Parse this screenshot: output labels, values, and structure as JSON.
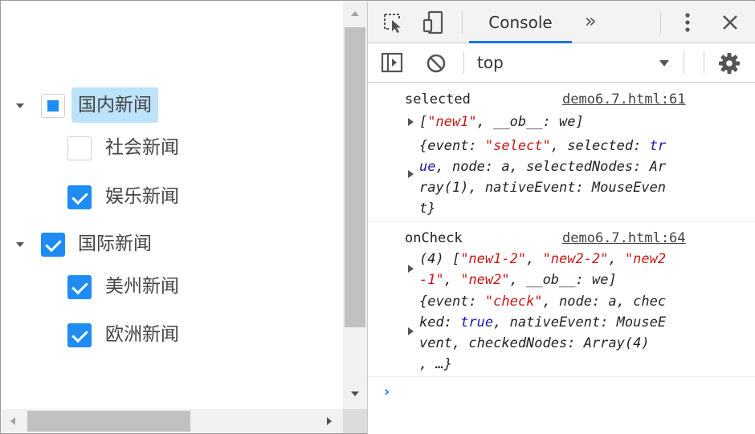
{
  "tree": {
    "nodes": [
      {
        "label": "国内新闻",
        "state": "indeterminate",
        "selected": true,
        "expanded": true,
        "level": 0
      },
      {
        "label": "社会新闻",
        "state": "unchecked",
        "selected": false,
        "level": 1
      },
      {
        "label": "娱乐新闻",
        "state": "checked",
        "selected": false,
        "level": 1
      },
      {
        "label": "国际新闻",
        "state": "checked",
        "selected": false,
        "expanded": true,
        "level": 0
      },
      {
        "label": "美州新闻",
        "state": "checked",
        "selected": false,
        "level": 1
      },
      {
        "label": "欧洲新闻",
        "state": "checked",
        "selected": false,
        "level": 1
      }
    ]
  },
  "devtools": {
    "tabs": {
      "active": "Console",
      "more": "»"
    },
    "context": "top",
    "icons": {
      "inspect": "inspect-element-icon",
      "device": "device-toolbar-icon",
      "menu": "more-options-icon",
      "close": "close-icon",
      "sidebar": "console-sidebar-icon",
      "clear": "clear-console-icon",
      "dropdown": "chevron-down-icon",
      "settings": "gear-icon"
    },
    "console": {
      "entries": [
        {
          "label": "selected",
          "source": "demo6.7.html:61",
          "array_line": "[\"new1\", __ob__: we]",
          "object_lines": [
            "{event: \"select\", selected: tr",
            "ue, node: a, selectedNodes: Ar",
            "ray(1), nativeEvent: MouseEven",
            "t}"
          ]
        },
        {
          "label": "onCheck",
          "source": "demo6.7.html:64",
          "array_lines": [
            "(4) [\"new1-2\", \"new2-2\", \"new2",
            "-1\", \"new2\", __ob__: we]"
          ],
          "object_lines": [
            "{event: \"check\", node: a, chec",
            "ked: true, nativeEvent: MouseE",
            "vent, checkedNodes: Array(4)",
            ", …}"
          ]
        }
      ],
      "prompt": "›"
    }
  },
  "colors": {
    "accent": "#1e8cf2",
    "selected_bg": "#bde3fb",
    "string": "#c41a16",
    "boolean": "#1a1aa6",
    "tab_underline": "#1a73e8"
  }
}
